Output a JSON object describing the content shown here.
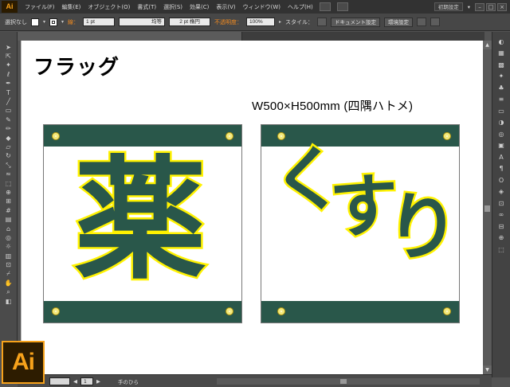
{
  "app": {
    "logo_text": "Ai",
    "big_logo_text": "Ai"
  },
  "menu": [
    "ファイル(F)",
    "編集(E)",
    "オブジェクト(O)",
    "書式(T)",
    "選択(S)",
    "効果(C)",
    "表示(V)",
    "ウィンドウ(W)",
    "ヘルプ(H)"
  ],
  "workspace": {
    "label": "初期設定"
  },
  "control_bar": {
    "selection": "選択なし",
    "stroke_label": "線：",
    "stroke_weight": "1 pt",
    "stroke_profile": "均等",
    "brush": "2 pt 楕円",
    "opacity_label": "不透明度：",
    "opacity_value": "100%",
    "style_label": "スタイル：",
    "doc_setup": "ドキュメント設定",
    "prefs": "環境設定"
  },
  "document_tab": {
    "title": ""
  },
  "artboard": {
    "title": "フラッグ",
    "size_note": "W500×H500mm (四隅ハトメ)",
    "flags": [
      {
        "text": "薬"
      },
      {
        "chars": [
          "く",
          "す",
          "り"
        ]
      }
    ],
    "colors": {
      "band": "#29574a",
      "text": "#29574a",
      "outline": "#fff200",
      "grommet": "#f3e97c"
    }
  },
  "status_bar": {
    "zoom": "",
    "page": "1",
    "tool_name": "手のひら"
  },
  "tools": [
    "selection-tool",
    "direct-selection-tool",
    "magic-wand-tool",
    "lasso-tool",
    "pen-tool",
    "type-tool",
    "line-tool",
    "rectangle-tool",
    "paintbrush-tool",
    "pencil-tool",
    "blob-brush-tool",
    "eraser-tool",
    "rotate-tool",
    "scale-tool",
    "warp-tool",
    "free-transform-tool",
    "shape-builder-tool",
    "perspective-grid-tool",
    "mesh-tool",
    "gradient-tool",
    "eyedropper-tool",
    "blend-tool",
    "symbol-sprayer-tool",
    "column-graph-tool",
    "artboard-tool",
    "slice-tool",
    "hand-tool",
    "zoom-tool"
  ]
}
